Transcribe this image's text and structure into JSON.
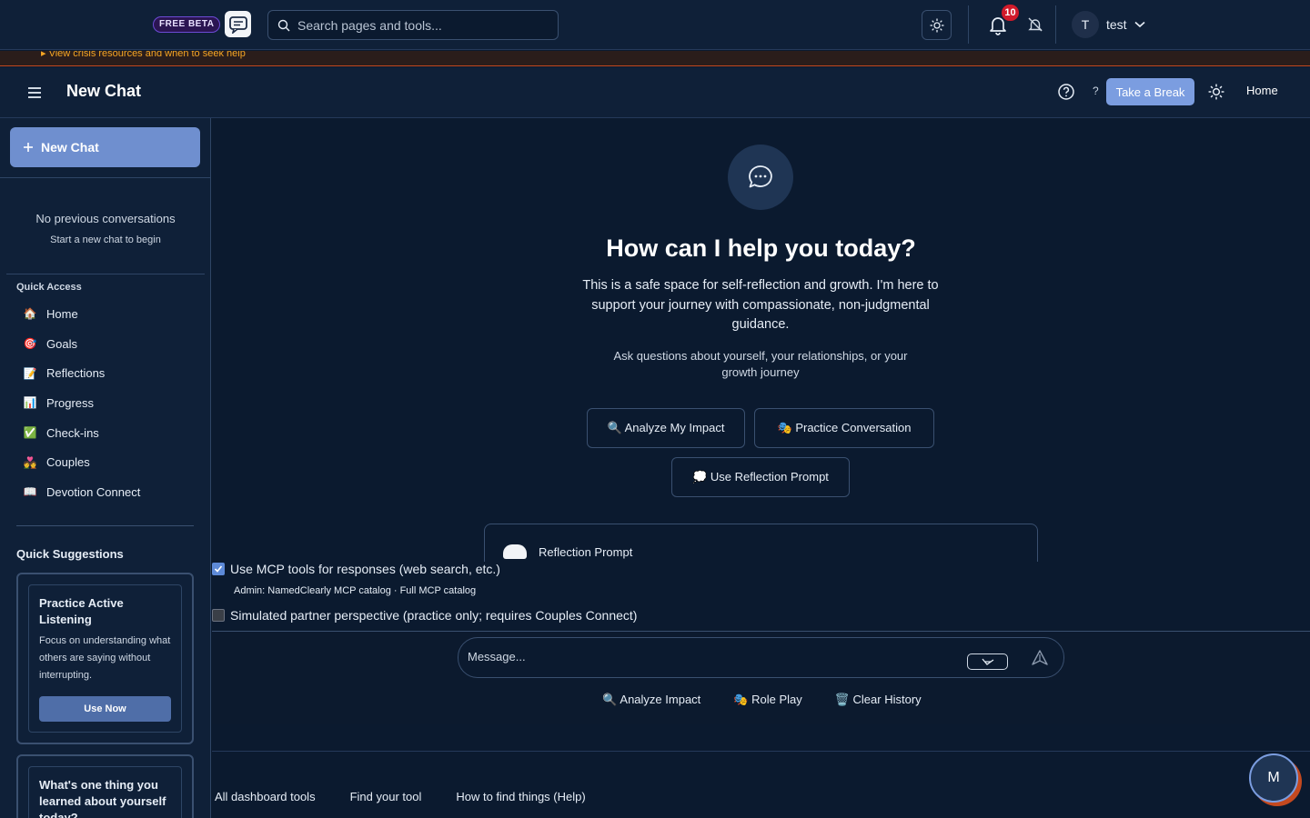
{
  "topbar": {
    "beta_label": "FREE BETA",
    "search_placeholder": "Search pages and tools...",
    "notification_count": "10",
    "user_initial": "T",
    "user_name": "test"
  },
  "crisis": {
    "link": "▸ View crisis resources and when to seek help"
  },
  "header": {
    "title": "New Chat",
    "help_mark": "?",
    "break_label": "Take a Break",
    "home_label": "Home"
  },
  "sidebar": {
    "new_chat": "New Chat",
    "empty_title": "No previous conversations",
    "empty_sub": "Start a new chat to begin",
    "quick_access_title": "Quick Access",
    "items": [
      {
        "emoji": "🏠",
        "label": "Home"
      },
      {
        "emoji": "🎯",
        "label": "Goals"
      },
      {
        "emoji": "📝",
        "label": "Reflections"
      },
      {
        "emoji": "📊",
        "label": "Progress"
      },
      {
        "emoji": "✅",
        "label": "Check-ins"
      },
      {
        "emoji": "💑",
        "label": "Couples"
      },
      {
        "emoji": "📖",
        "label": "Devotion Connect"
      }
    ],
    "suggestions_title": "Quick Suggestions",
    "suggestions": [
      {
        "title": "Practice Active Listening",
        "desc": "Focus on understanding what others are saying without interrupting.",
        "button": "Use Now"
      },
      {
        "title": "What's one thing you learned about yourself today?"
      }
    ]
  },
  "main": {
    "hero_title": "How can I help you today?",
    "hero_desc": "This is a safe space for self-reflection and growth. I'm here to support your journey with compassionate, non-judgmental guidance.",
    "hero_sub": "Ask questions about yourself, your relationships, or your growth journey",
    "btn_analyze": "🔍 Analyze My Impact",
    "btn_practice": "🎭 Practice Conversation",
    "btn_reflection": "💭 Use Reflection Prompt",
    "reflection_card_title": "Reflection Prompt",
    "mcp_label": "Use MCP tools for responses (web search, etc.)",
    "mcp_checked": true,
    "admin_line": "Admin: NamedClearly MCP catalog · Full MCP catalog",
    "simulated_label": "Simulated partner perspective (practice only; requires Couples Connect)",
    "simulated_checked": false,
    "message_placeholder": "Message...",
    "quick": {
      "analyze": "🔍 Analyze Impact",
      "roleplay": "🎭 Role Play",
      "clear": "🗑️ Clear History"
    },
    "footer": {
      "all_tools": "All dashboard tools",
      "find_tool": "Find your tool",
      "help": "How to find things (Help)"
    },
    "fab_initial": "M"
  }
}
